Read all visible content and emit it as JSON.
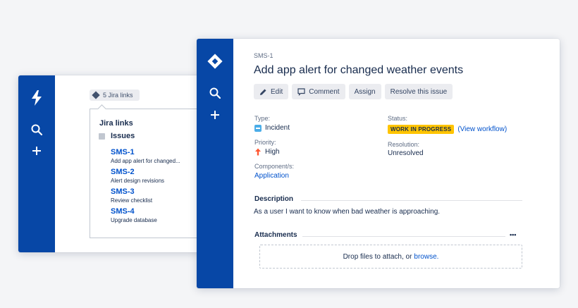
{
  "back_card": {
    "pill_label": "5 Jira links",
    "popover": {
      "title": "Jira links",
      "group_label": "Issues",
      "items": [
        {
          "key": "SMS-1",
          "summary": "Add app alert for changed..."
        },
        {
          "key": "SMS-2",
          "summary": "Alert design revisions"
        },
        {
          "key": "SMS-3",
          "summary": "Review checklist"
        },
        {
          "key": "SMS-4",
          "summary": "Upgrade database"
        }
      ]
    }
  },
  "issue": {
    "key": "SMS-1",
    "title": "Add app alert for changed weather events",
    "toolbar": {
      "edit": "Edit",
      "comment": "Comment",
      "assign": "Assign",
      "resolve": "Resolve this issue"
    },
    "fields": {
      "type_label": "Type:",
      "type_value": "Incident",
      "priority_label": "Priority:",
      "priority_value": "High",
      "components_label": "Component/s:",
      "components_value": "Application",
      "status_label": "Status:",
      "status_value": "WORK IN PROGRESS",
      "status_link": "(View workflow)",
      "resolution_label": "Resolution:",
      "resolution_value": "Unresolved"
    },
    "description": {
      "title": "Description",
      "text": "As a user I want to know when bad weather is approaching."
    },
    "attachments": {
      "title": "Attachments",
      "more": "•••",
      "drop_text": "Drop files to attach, or ",
      "browse_link": "browse."
    }
  },
  "colors": {
    "sidebar": "#0747a6",
    "link": "#0052cc",
    "status_lozenge": "#ffc400",
    "priority_high": "#ff5630",
    "incident_icon": "#4bade8"
  },
  "icons": [
    "jira-logo-icon",
    "search-icon",
    "plus-icon",
    "edit-icon",
    "comment-icon",
    "incident-icon",
    "arrow-up-icon",
    "link-diamond-icon",
    "more-icon"
  ]
}
